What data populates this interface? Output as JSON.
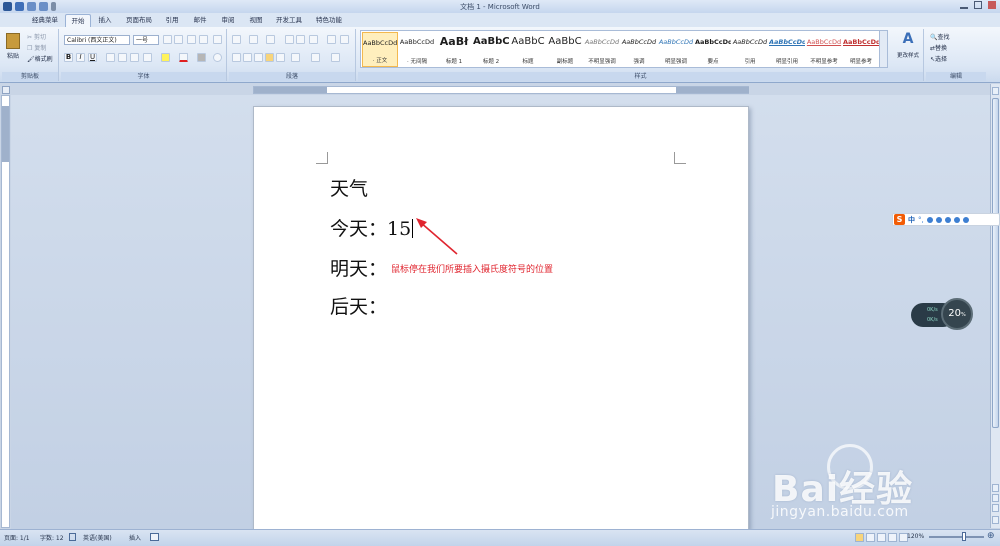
{
  "window": {
    "title": "文档 1 - Microsoft Word"
  },
  "tabs": [
    "经典菜单",
    "开始",
    "插入",
    "页面布局",
    "引用",
    "邮件",
    "审阅",
    "视图",
    "开发工具",
    "特色功能"
  ],
  "active_tab": "开始",
  "ribbon": {
    "clipboard": {
      "paste": "粘贴",
      "cut": "剪切",
      "copy": "复制",
      "format_painter": "格式刷",
      "label": "剪贴板"
    },
    "font": {
      "font_name": "Calibri (西文正文)",
      "font_size": "一号",
      "label": "字体"
    },
    "paragraph": {
      "label": "段落"
    },
    "styles": {
      "items": [
        {
          "preview": "AaBbCcDd",
          "name": "· 正文"
        },
        {
          "preview": "AaBbCcDd",
          "name": "· 无间隔"
        },
        {
          "preview": "AaBł",
          "name": "标题 1"
        },
        {
          "preview": "AaBbC",
          "name": "标题 2"
        },
        {
          "preview": "AaBbC",
          "name": "标题"
        },
        {
          "preview": "AaBbC",
          "name": "副标题"
        },
        {
          "preview": "AaBbCcDd",
          "name": "不明显强调"
        },
        {
          "preview": "AaBbCcDd",
          "name": "强调"
        },
        {
          "preview": "AaBbCcDd",
          "name": "明显强调"
        },
        {
          "preview": "AaBbCcDd",
          "name": "要点"
        },
        {
          "preview": "AaBbCcDd",
          "name": "引用"
        },
        {
          "preview": "AaBbCcDd",
          "name": "明显引用"
        },
        {
          "preview": "AaBbCcDd",
          "name": "不明显参考"
        },
        {
          "preview": "AaBbCcDd",
          "name": "明显参考"
        }
      ],
      "change_styles": "更改样式",
      "label": "样式"
    },
    "editing": {
      "find": "查找",
      "replace": "替换",
      "select": "选择",
      "label": "编辑"
    }
  },
  "document": {
    "lines": [
      "天气",
      "今天：15",
      "明天：",
      "后天："
    ],
    "annotation": "鼠标停在我们所要插入摄氏度符号的位置"
  },
  "ime": {
    "label": "中"
  },
  "speed_widget": {
    "value": "20",
    "unit": "%",
    "up": "0K/s",
    "down": "0K/s"
  },
  "statusbar": {
    "page": "页面: 1/1",
    "words": "字数: 12",
    "language": "英语(美国)",
    "mode": "插入",
    "zoom": "120%"
  },
  "watermark": {
    "brand": "Bai经验",
    "url": "jingyan.baidu.com"
  }
}
